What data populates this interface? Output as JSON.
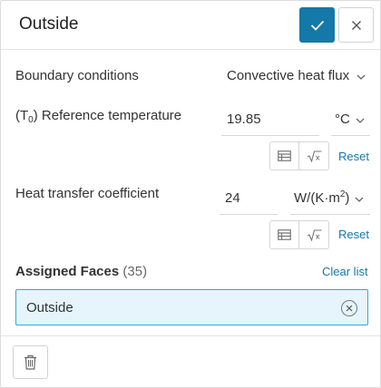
{
  "header": {
    "title": "Outside",
    "confirm_icon": "check-icon",
    "close_icon": "close-icon"
  },
  "boundary_conditions": {
    "label": "Boundary conditions",
    "value": "Convective heat flux"
  },
  "reference_temperature": {
    "label_prefix": "(T",
    "label_sub": "0",
    "label_suffix": ") Reference temperature",
    "value": "19.85",
    "unit": "°C",
    "reset_label": "Reset"
  },
  "heat_transfer_coefficient": {
    "label": "Heat transfer coefficient",
    "value": "24",
    "unit_main": "W/(K·m",
    "unit_sup": "2",
    "unit_close": ")",
    "reset_label": "Reset"
  },
  "assigned_faces": {
    "title": "Assigned Faces",
    "count": "(35)",
    "clear_label": "Clear list",
    "items": [
      "Outside"
    ]
  },
  "footer": {
    "delete_icon": "trash-icon"
  },
  "colors": {
    "accent": "#1479a8",
    "chip_bg": "#e5f5fb",
    "chip_border": "#3ba6cf"
  }
}
